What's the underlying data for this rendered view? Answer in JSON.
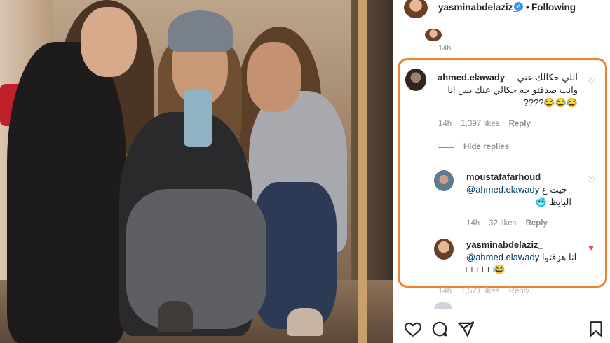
{
  "post": {
    "author": "yasminabdelaziz_",
    "follow_status": "Following",
    "separator": "•",
    "verified_mark": "✓"
  },
  "thread": {
    "prev_time": "14h",
    "hide_replies_label": "Hide replies"
  },
  "comments": [
    {
      "username": "ahmed.elawady",
      "text_line1": "اللي حكالك عني",
      "text_line2": "وانت صدقتو جه حكالي عنك بس انا",
      "text_line3": "????😂😂😂",
      "time": "14h",
      "likes": "1,397 likes",
      "reply": "Reply",
      "liked": false
    }
  ],
  "replies": [
    {
      "username": "moustafafarhoud",
      "mention": "@ahmed.elawady",
      "text_after_mention": " جيت ع",
      "text_line2": "البايظ 🥶",
      "time": "14h",
      "likes": "32 likes",
      "reply": "Reply",
      "liked": false
    },
    {
      "username": "yasminabdelaziz_",
      "mention": "@ahmed.elawady",
      "text_after_mention": " انا هزقتوا",
      "text_line2": "😂",
      "text_line2_prefix": "□□□□□",
      "liked": true
    }
  ],
  "faded_next": {
    "time": "14h",
    "likes": "1,521 likes",
    "reply": "Reply"
  },
  "icons": {
    "like": "heart-outline-icon",
    "comment": "comment-bubble-icon",
    "share": "paper-plane-icon",
    "save": "bookmark-icon"
  },
  "colors": {
    "highlight": "#f0832a",
    "liked_heart": "#ed4956",
    "verified": "#3897f0",
    "mention": "#00376b"
  }
}
